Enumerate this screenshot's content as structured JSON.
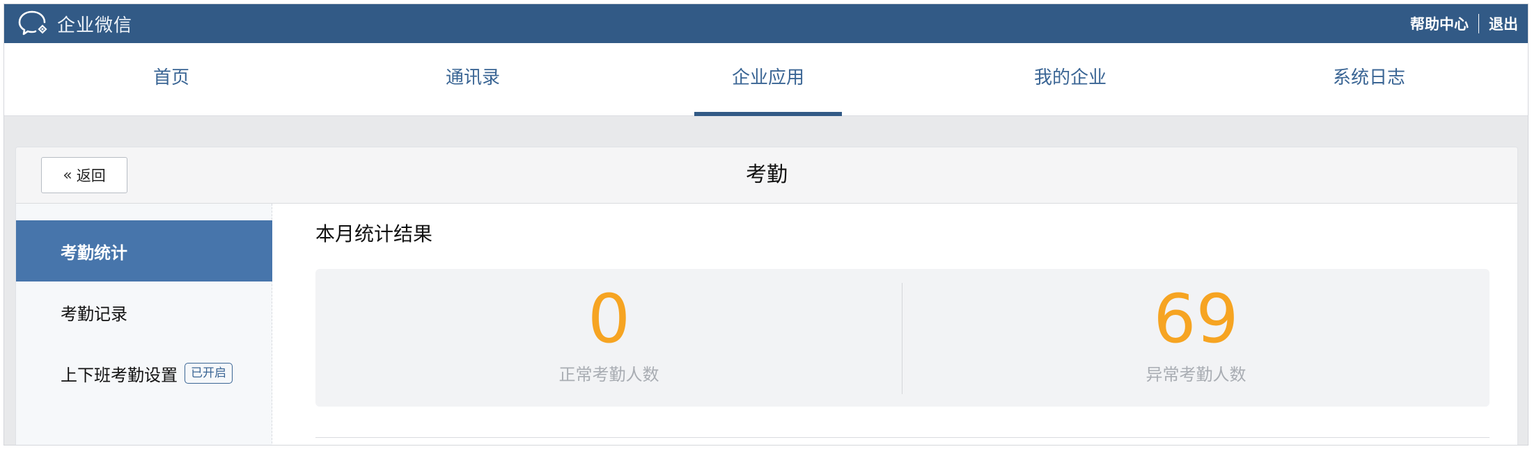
{
  "app": {
    "brand_name": "企业微信",
    "logo_icon": "wechat-work-logo-icon"
  },
  "top_links": {
    "help_label": "帮助中心",
    "logout_label": "退出"
  },
  "nav": {
    "items": [
      {
        "label": "首页",
        "active": false
      },
      {
        "label": "通讯录",
        "active": false
      },
      {
        "label": "企业应用",
        "active": true
      },
      {
        "label": "我的企业",
        "active": false
      },
      {
        "label": "系统日志",
        "active": false
      }
    ]
  },
  "page": {
    "back_label": "返回",
    "back_icon": "double-chevron-left-icon",
    "title": "考勤"
  },
  "sidebar": {
    "items": [
      {
        "label": "考勤统计",
        "active": true
      },
      {
        "label": "考勤记录",
        "active": false
      },
      {
        "label": "上下班考勤设置",
        "active": false,
        "badge": "已开启"
      }
    ]
  },
  "content": {
    "section_title": "本月统计结果",
    "stats": [
      {
        "value": "0",
        "label": "正常考勤人数"
      },
      {
        "value": "69",
        "label": "异常考勤人数"
      }
    ]
  },
  "colors": {
    "header_bg": "#325a86",
    "nav_text": "#3a6594",
    "sidebar_active_bg": "#4775ab",
    "stat_value": "#f6a422",
    "stat_label": "#a9adb3"
  }
}
